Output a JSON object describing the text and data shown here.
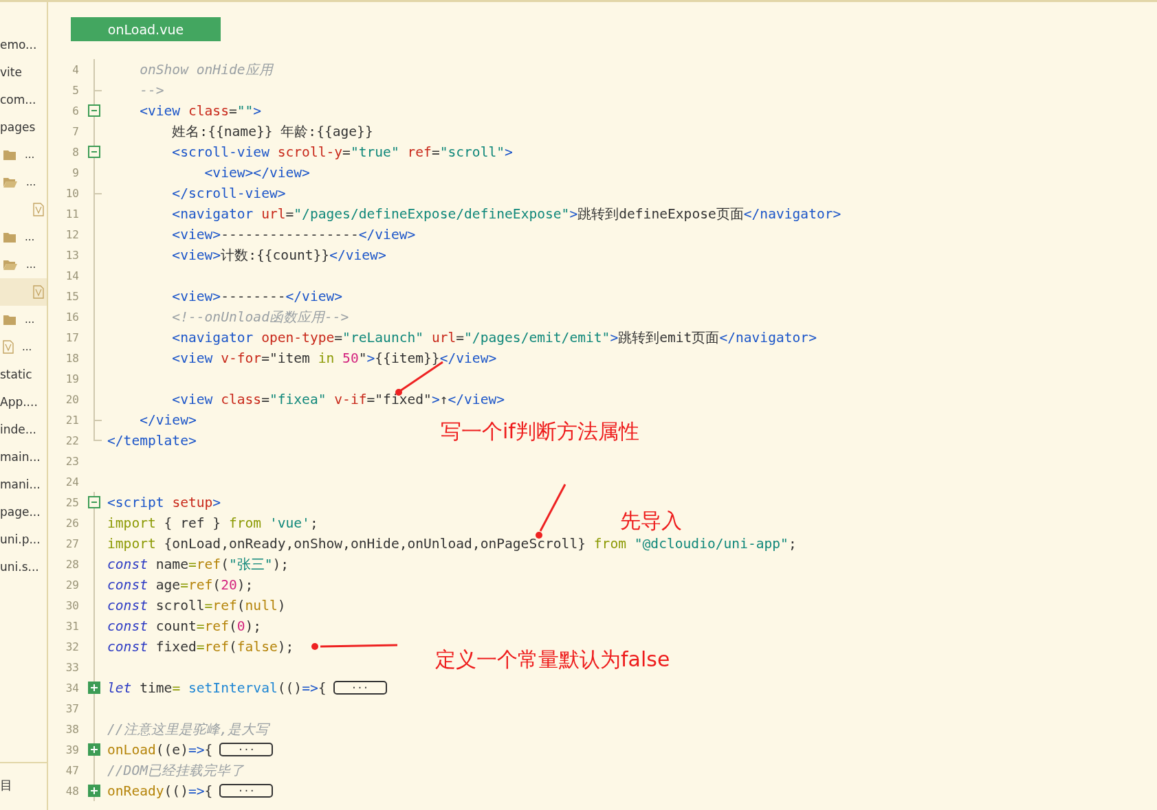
{
  "sidebar": {
    "items": [
      {
        "kind": "text",
        "text": "emo...",
        "selected": false
      },
      {
        "kind": "text",
        "text": "vite",
        "selected": false
      },
      {
        "kind": "text",
        "text": "com...",
        "selected": false
      },
      {
        "kind": "text",
        "text": "pages",
        "selected": false
      },
      {
        "kind": "folder",
        "text": "...",
        "selected": false
      },
      {
        "kind": "folder-open",
        "text": "...",
        "selected": false
      },
      {
        "kind": "file",
        "selected": false
      },
      {
        "kind": "folder",
        "text": "...",
        "selected": false
      },
      {
        "kind": "folder-open",
        "text": "...",
        "selected": false
      },
      {
        "kind": "file",
        "selected": true
      },
      {
        "kind": "folder",
        "text": "...",
        "selected": false
      },
      {
        "kind": "file",
        "text": "...",
        "selected": false
      },
      {
        "kind": "text",
        "text": "static",
        "selected": false
      },
      {
        "kind": "text",
        "text": "App....",
        "selected": false
      },
      {
        "kind": "text",
        "text": "inde...",
        "selected": false
      },
      {
        "kind": "text",
        "text": "main...",
        "selected": false
      },
      {
        "kind": "text",
        "text": "mani...",
        "selected": false
      },
      {
        "kind": "text",
        "text": "page...",
        "selected": false
      },
      {
        "kind": "text",
        "text": "uni.p...",
        "selected": false
      },
      {
        "kind": "text",
        "text": "uni.s...",
        "selected": false
      }
    ],
    "footer": "目"
  },
  "tab": {
    "label": "onLoad.vue",
    "selected": true
  },
  "lines": [
    {
      "number": "4",
      "kind": "code",
      "tokens": [
        {
          "kind": "comment",
          "text": "    onShow onHide应用"
        }
      ]
    },
    {
      "number": "5",
      "kind": "branch",
      "tokens": [
        {
          "kind": "comment",
          "text": "    -->"
        }
      ]
    },
    {
      "number": "6",
      "kind": "code",
      "expanded": true,
      "tokens": [
        {
          "kind": "tag",
          "text": "    <view "
        },
        {
          "kind": "attr",
          "text": "class"
        },
        {
          "kind": "plain",
          "text": "="
        },
        {
          "kind": "string",
          "text": "\"\""
        },
        {
          "kind": "tag",
          "text": ">"
        }
      ]
    },
    {
      "number": "7",
      "kind": "code",
      "tokens": [
        {
          "kind": "plain",
          "text": "        姓名:{{name}} 年龄:{{age}}"
        }
      ]
    },
    {
      "number": "8",
      "kind": "code",
      "expanded": true,
      "tokens": [
        {
          "kind": "tag",
          "text": "        <scroll-view "
        },
        {
          "kind": "attr",
          "text": "scroll-y"
        },
        {
          "kind": "plain",
          "text": "="
        },
        {
          "kind": "string",
          "text": "\"true\" "
        },
        {
          "kind": "attr",
          "text": "ref"
        },
        {
          "kind": "plain",
          "text": "="
        },
        {
          "kind": "string",
          "text": "\"scroll\""
        },
        {
          "kind": "tag",
          "text": ">"
        }
      ]
    },
    {
      "number": "9",
      "kind": "code",
      "tokens": [
        {
          "kind": "tag",
          "text": "            <view></view>"
        }
      ]
    },
    {
      "number": "10",
      "kind": "branch",
      "tokens": [
        {
          "kind": "tag",
          "text": "        </scroll-view>"
        }
      ]
    },
    {
      "number": "11",
      "kind": "code",
      "tokens": [
        {
          "kind": "tag",
          "text": "        <navigator "
        },
        {
          "kind": "attr",
          "text": "url"
        },
        {
          "kind": "plain",
          "text": "="
        },
        {
          "kind": "string",
          "text": "\"/pages/defineExpose/defineExpose\""
        },
        {
          "kind": "tag",
          "text": ">"
        },
        {
          "kind": "plain",
          "text": "跳转到defineExpose页面"
        },
        {
          "kind": "tag",
          "text": "</navigator>"
        }
      ]
    },
    {
      "number": "12",
      "kind": "code",
      "tokens": [
        {
          "kind": "tag",
          "text": "        <view>"
        },
        {
          "kind": "plain",
          "text": "-----------------"
        },
        {
          "kind": "tag",
          "text": "</view>"
        }
      ]
    },
    {
      "number": "13",
      "kind": "code",
      "tokens": [
        {
          "kind": "tag",
          "text": "        <view>"
        },
        {
          "kind": "plain",
          "text": "计数:{{count}}"
        },
        {
          "kind": "tag",
          "text": "</view>"
        }
      ]
    },
    {
      "number": "14",
      "kind": "code"
    },
    {
      "number": "15",
      "kind": "code",
      "tokens": [
        {
          "kind": "tag",
          "text": "        <view>"
        },
        {
          "kind": "plain",
          "text": "--------"
        },
        {
          "kind": "tag",
          "text": "</view>"
        }
      ]
    },
    {
      "number": "16",
      "kind": "code",
      "tokens": [
        {
          "kind": "comment",
          "text": "        <!--onUnload函数应用-->"
        }
      ]
    },
    {
      "number": "17",
      "kind": "code",
      "tokens": [
        {
          "kind": "tag",
          "text": "        <navigator "
        },
        {
          "kind": "attr",
          "text": "open-type"
        },
        {
          "kind": "plain",
          "text": "="
        },
        {
          "kind": "string",
          "text": "\"reLaunch\" "
        },
        {
          "kind": "attr",
          "text": "url"
        },
        {
          "kind": "plain",
          "text": "="
        },
        {
          "kind": "string",
          "text": "\"/pages/emit/emit\""
        },
        {
          "kind": "tag",
          "text": ">"
        },
        {
          "kind": "plain",
          "text": "跳转到emit页面"
        },
        {
          "kind": "tag",
          "text": "</navigator>"
        }
      ]
    },
    {
      "number": "18",
      "kind": "code",
      "tokens": [
        {
          "kind": "tag",
          "text": "        <view "
        },
        {
          "kind": "attr",
          "text": "v-for"
        },
        {
          "kind": "plain",
          "text": "=\"item "
        },
        {
          "kind": "keyword",
          "text": "in "
        },
        {
          "kind": "number",
          "text": "50"
        },
        {
          "kind": "plain",
          "text": "\""
        },
        {
          "kind": "tag",
          "text": ">"
        },
        {
          "kind": "plain",
          "text": "{{item}}"
        },
        {
          "kind": "tag",
          "text": "</view>"
        }
      ]
    },
    {
      "number": "19",
      "kind": "code"
    },
    {
      "number": "20",
      "kind": "code",
      "tokens": [
        {
          "kind": "tag",
          "text": "        <view "
        },
        {
          "kind": "attr",
          "text": "class"
        },
        {
          "kind": "plain",
          "text": "="
        },
        {
          "kind": "string",
          "text": "\"fixea\" "
        },
        {
          "kind": "attr",
          "text": "v-if"
        },
        {
          "kind": "plain",
          "text": "=\"fixed\""
        },
        {
          "kind": "tag",
          "text": ">"
        },
        {
          "kind": "plain",
          "text": "↑"
        },
        {
          "kind": "tag",
          "text": "</view>"
        }
      ]
    },
    {
      "number": "21",
      "kind": "branch",
      "tokens": [
        {
          "kind": "tag",
          "text": "    </view>"
        }
      ]
    },
    {
      "number": "22",
      "kind": "end",
      "tokens": [
        {
          "kind": "tag",
          "text": "</template>"
        }
      ]
    },
    {
      "number": "23",
      "kind": "blank"
    },
    {
      "number": "24",
      "kind": "blank"
    },
    {
      "number": "25",
      "kind": "code",
      "expanded": true,
      "tokens": [
        {
          "kind": "tag",
          "text": "<script "
        },
        {
          "kind": "attr",
          "text": "setup"
        },
        {
          "kind": "tag",
          "text": ">"
        }
      ]
    },
    {
      "number": "26",
      "kind": "code",
      "tokens": [
        {
          "kind": "keyword",
          "text": "import"
        },
        {
          "kind": "plain",
          "text": " { ref } "
        },
        {
          "kind": "keyword",
          "text": "from "
        },
        {
          "kind": "string",
          "text": "'vue'"
        },
        {
          "kind": "plain",
          "text": ";"
        }
      ]
    },
    {
      "number": "27",
      "kind": "code",
      "tokens": [
        {
          "kind": "keyword",
          "text": "import"
        },
        {
          "kind": "plain",
          "text": " {onLoad,onReady,onShow,onHide,onUnload,onPageScroll} "
        },
        {
          "kind": "keyword",
          "text": "from "
        },
        {
          "kind": "string",
          "text": "\"@dcloudio/uni-app\""
        },
        {
          "kind": "plain",
          "text": ";"
        }
      ]
    },
    {
      "number": "28",
      "kind": "code",
      "tokens": [
        {
          "kind": "decl",
          "text": "const"
        },
        {
          "kind": "plain",
          "text": " name"
        },
        {
          "kind": "keyword",
          "text": "="
        },
        {
          "kind": "func",
          "text": "ref"
        },
        {
          "kind": "plain",
          "text": "("
        },
        {
          "kind": "string",
          "text": "\"张三\""
        },
        {
          "kind": "plain",
          "text": ");"
        }
      ]
    },
    {
      "number": "29",
      "kind": "code",
      "tokens": [
        {
          "kind": "decl",
          "text": "const"
        },
        {
          "kind": "plain",
          "text": " age"
        },
        {
          "kind": "keyword",
          "text": "="
        },
        {
          "kind": "func",
          "text": "ref"
        },
        {
          "kind": "plain",
          "text": "("
        },
        {
          "kind": "number",
          "text": "20"
        },
        {
          "kind": "plain",
          "text": ");"
        }
      ]
    },
    {
      "number": "30",
      "kind": "code",
      "tokens": [
        {
          "kind": "decl",
          "text": "const"
        },
        {
          "kind": "plain",
          "text": " scroll"
        },
        {
          "kind": "keyword",
          "text": "="
        },
        {
          "kind": "func",
          "text": "ref"
        },
        {
          "kind": "plain",
          "text": "("
        },
        {
          "kind": "func",
          "text": "null"
        },
        {
          "kind": "plain",
          "text": ")"
        }
      ]
    },
    {
      "number": "31",
      "kind": "code",
      "tokens": [
        {
          "kind": "decl",
          "text": "const"
        },
        {
          "kind": "plain",
          "text": " count"
        },
        {
          "kind": "keyword",
          "text": "="
        },
        {
          "kind": "func",
          "text": "ref"
        },
        {
          "kind": "plain",
          "text": "("
        },
        {
          "kind": "number",
          "text": "0"
        },
        {
          "kind": "plain",
          "text": ");"
        }
      ]
    },
    {
      "number": "32",
      "kind": "code",
      "tokens": [
        {
          "kind": "decl",
          "text": "const"
        },
        {
          "kind": "plain",
          "text": " fixed"
        },
        {
          "kind": "keyword",
          "text": "="
        },
        {
          "kind": "func",
          "text": "ref"
        },
        {
          "kind": "plain",
          "text": "("
        },
        {
          "kind": "func",
          "text": "false"
        },
        {
          "kind": "plain",
          "text": ");"
        }
      ]
    },
    {
      "number": "33",
      "kind": "code"
    },
    {
      "number": "34",
      "kind": "code",
      "expanded": false,
      "tokens": [
        {
          "kind": "decl",
          "text": "let"
        },
        {
          "kind": "plain",
          "text": " time"
        },
        {
          "kind": "keyword",
          "text": "="
        },
        {
          "kind": "call",
          "text": " setInterval"
        },
        {
          "kind": "plain",
          "text": "(()"
        },
        {
          "kind": "tag",
          "text": "=>"
        },
        {
          "kind": "plain",
          "text": "{"
        }
      ],
      "folded": "···"
    },
    {
      "number": "37",
      "kind": "code"
    },
    {
      "number": "38",
      "kind": "code",
      "tokens": [
        {
          "kind": "comment",
          "text": "//注意这里是驼峰,是大写"
        }
      ]
    },
    {
      "number": "39",
      "kind": "code",
      "expanded": false,
      "tokens": [
        {
          "kind": "func",
          "text": "onLoad"
        },
        {
          "kind": "plain",
          "text": "((e)"
        },
        {
          "kind": "tag",
          "text": "=>"
        },
        {
          "kind": "plain",
          "text": "{"
        }
      ],
      "folded": "···"
    },
    {
      "number": "47",
      "kind": "code",
      "tokens": [
        {
          "kind": "comment",
          "text": "//DOM已经挂载完毕了"
        }
      ]
    },
    {
      "number": "48",
      "kind": "code",
      "expanded": false,
      "tokens": [
        {
          "kind": "func",
          "text": "onReady"
        },
        {
          "kind": "plain",
          "text": "(()"
        },
        {
          "kind": "tag",
          "text": "=>"
        },
        {
          "kind": "plain",
          "text": "{"
        }
      ],
      "folded": "···"
    }
  ],
  "annotations": [
    {
      "text": "写一个if判断方法属性"
    },
    {
      "text": "先导入"
    },
    {
      "text": "定义一个常量默认为false"
    }
  ]
}
